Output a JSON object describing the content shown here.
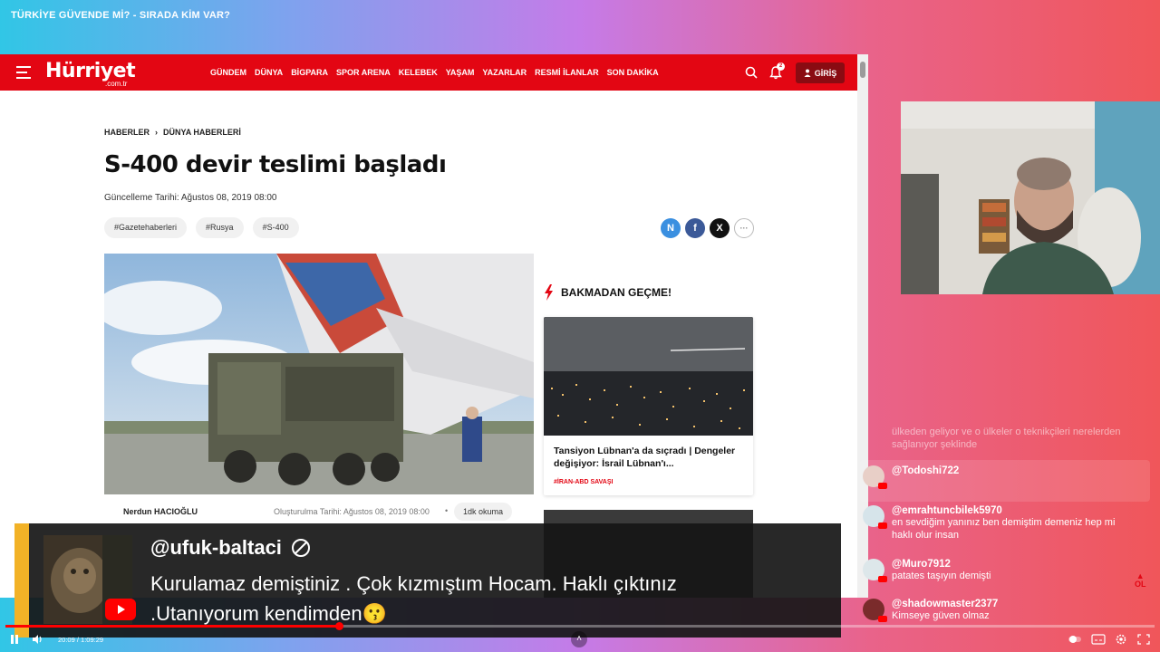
{
  "stream": {
    "title": "TÜRKİYE GÜVENDE Mİ? - SIRADA KİM VAR?"
  },
  "site": {
    "logo": "Hürriyet",
    "logo_sub": ".com.tr",
    "nav": [
      "GÜNDEM",
      "DÜNYA",
      "BİGPARA",
      "SPOR ARENA",
      "KELEBEK",
      "YAŞAM",
      "YAZARLAR",
      "RESMİ İLANLAR",
      "SON DAKİKA"
    ],
    "notification_count": "2",
    "login_label": "GİRİŞ"
  },
  "article": {
    "breadcrumb": [
      "HABERLER",
      "DÜNYA HABERLERİ"
    ],
    "title": "S-400 devir teslimi başladı",
    "update_date": "Güncelleme Tarihi: Ağustos 08, 2019 08:00",
    "tags": [
      "#Gazetehaberleri",
      "#Rusya",
      "#S-400"
    ],
    "author": "Nerdun HACIOĞLU",
    "created_date": "Oluşturulma Tarihi: Ağustos 08, 2019 08:00",
    "read_time": "1dk okuma"
  },
  "sidebar": {
    "heading": "BAKMADAN GEÇME!",
    "card_title": "Tansiyon Lübnan'a da sıçradı | Dengeler değişiyor: İsrail Lübnan'ı...",
    "card_tag": "#İRAN-ABD SAVAŞI"
  },
  "superchat": {
    "user": "@ufuk-baltaci",
    "message": "Kurulamaz demiştiniz . Çok kızmıştım Hocam. Haklı çıktınız .Utanıyorum kendimden😗"
  },
  "chat": {
    "faded_text": "ülkeden geliyor ve o ülkeler o teknikçileri nerelerden sağlanıyor şeklinde",
    "messages": [
      {
        "user": "@Todoshi722",
        "text": ""
      },
      {
        "user": "@emrahtuncbilek5970",
        "text": "en sevdiğim yanınız ben demiştim demeniz hep mi haklı olur insan"
      },
      {
        "user": "@Muro7912",
        "text": "patates taşıyın demişti"
      },
      {
        "user": "@shadowmaster2377",
        "text": "Kimseye güven olmaz"
      }
    ]
  },
  "player": {
    "time": "20:09 / 1:09:29",
    "progress_fraction": 0.29
  },
  "colors": {
    "brand_red": "#e30613",
    "superchat_accent": "#f2b227"
  }
}
